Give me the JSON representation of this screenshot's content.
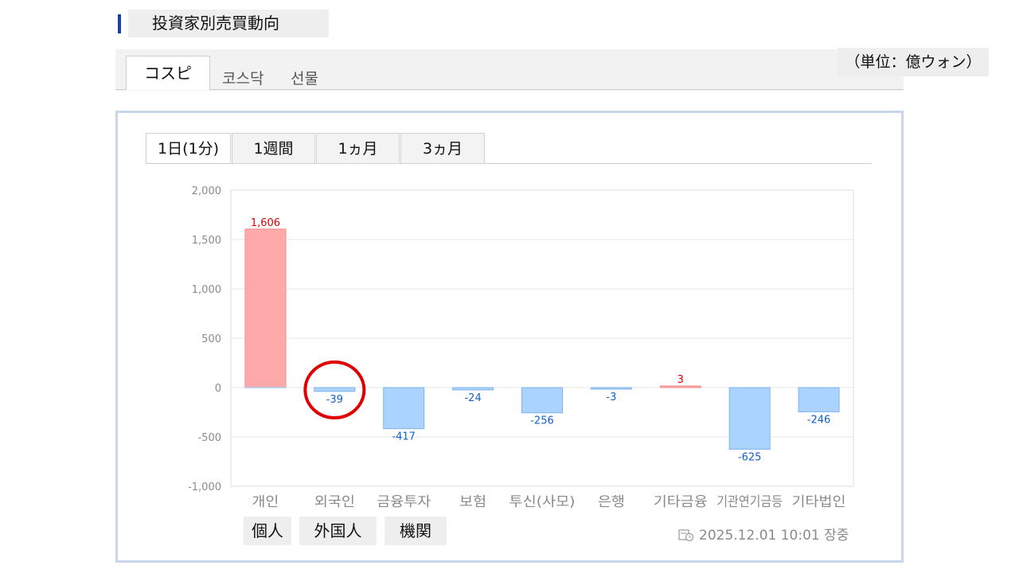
{
  "header": {
    "title": "投資家別売買動向"
  },
  "market_tabs": [
    {
      "label": "コスピ",
      "active": true
    },
    {
      "label": "코스닥",
      "active": false
    },
    {
      "label": "선물",
      "active": false
    }
  ],
  "unit_label": "（単位：億ウォン）",
  "period_tabs": [
    {
      "label": "1日(1分)",
      "active": true
    },
    {
      "label": "1週間",
      "active": false
    },
    {
      "label": "1ヵ月",
      "active": false
    },
    {
      "label": "3ヵ月",
      "active": false
    }
  ],
  "chart_data": {
    "type": "bar",
    "categories": [
      "개인",
      "외국인",
      "금융투자",
      "보험",
      "투신(사모)",
      "은행",
      "기타금융",
      "기관연기금등",
      "기타법인"
    ],
    "values": [
      1606,
      -39,
      -417,
      -24,
      -256,
      -3,
      3,
      -625,
      -246
    ],
    "value_labels": [
      "1,606",
      "-39",
      "-417",
      "-24",
      "-256",
      "-3",
      "3",
      "-625",
      "-246"
    ],
    "ylim": [
      -1000,
      2000
    ],
    "yticks": [
      2000,
      1500,
      1000,
      500,
      0,
      -500,
      -1000
    ],
    "ytick_labels": [
      "2,000",
      "1,500",
      "1,000",
      "500",
      "0",
      "-500",
      "-1,000"
    ],
    "grid": true,
    "colors": {
      "positive": "#ffaaaa",
      "positive_stroke": "#f08a8a",
      "positive_label": "#e00000",
      "negative": "#aad4ff",
      "negative_stroke": "#7fb3ea",
      "negative_label": "#1060d0",
      "zero_line": "#a9c9ef"
    },
    "highlight": {
      "category_index": 1,
      "color": "#e00000"
    }
  },
  "category_tags": [
    "個人",
    "外国人",
    "機関"
  ],
  "timestamp": "2025.12.01 10:01 장중"
}
